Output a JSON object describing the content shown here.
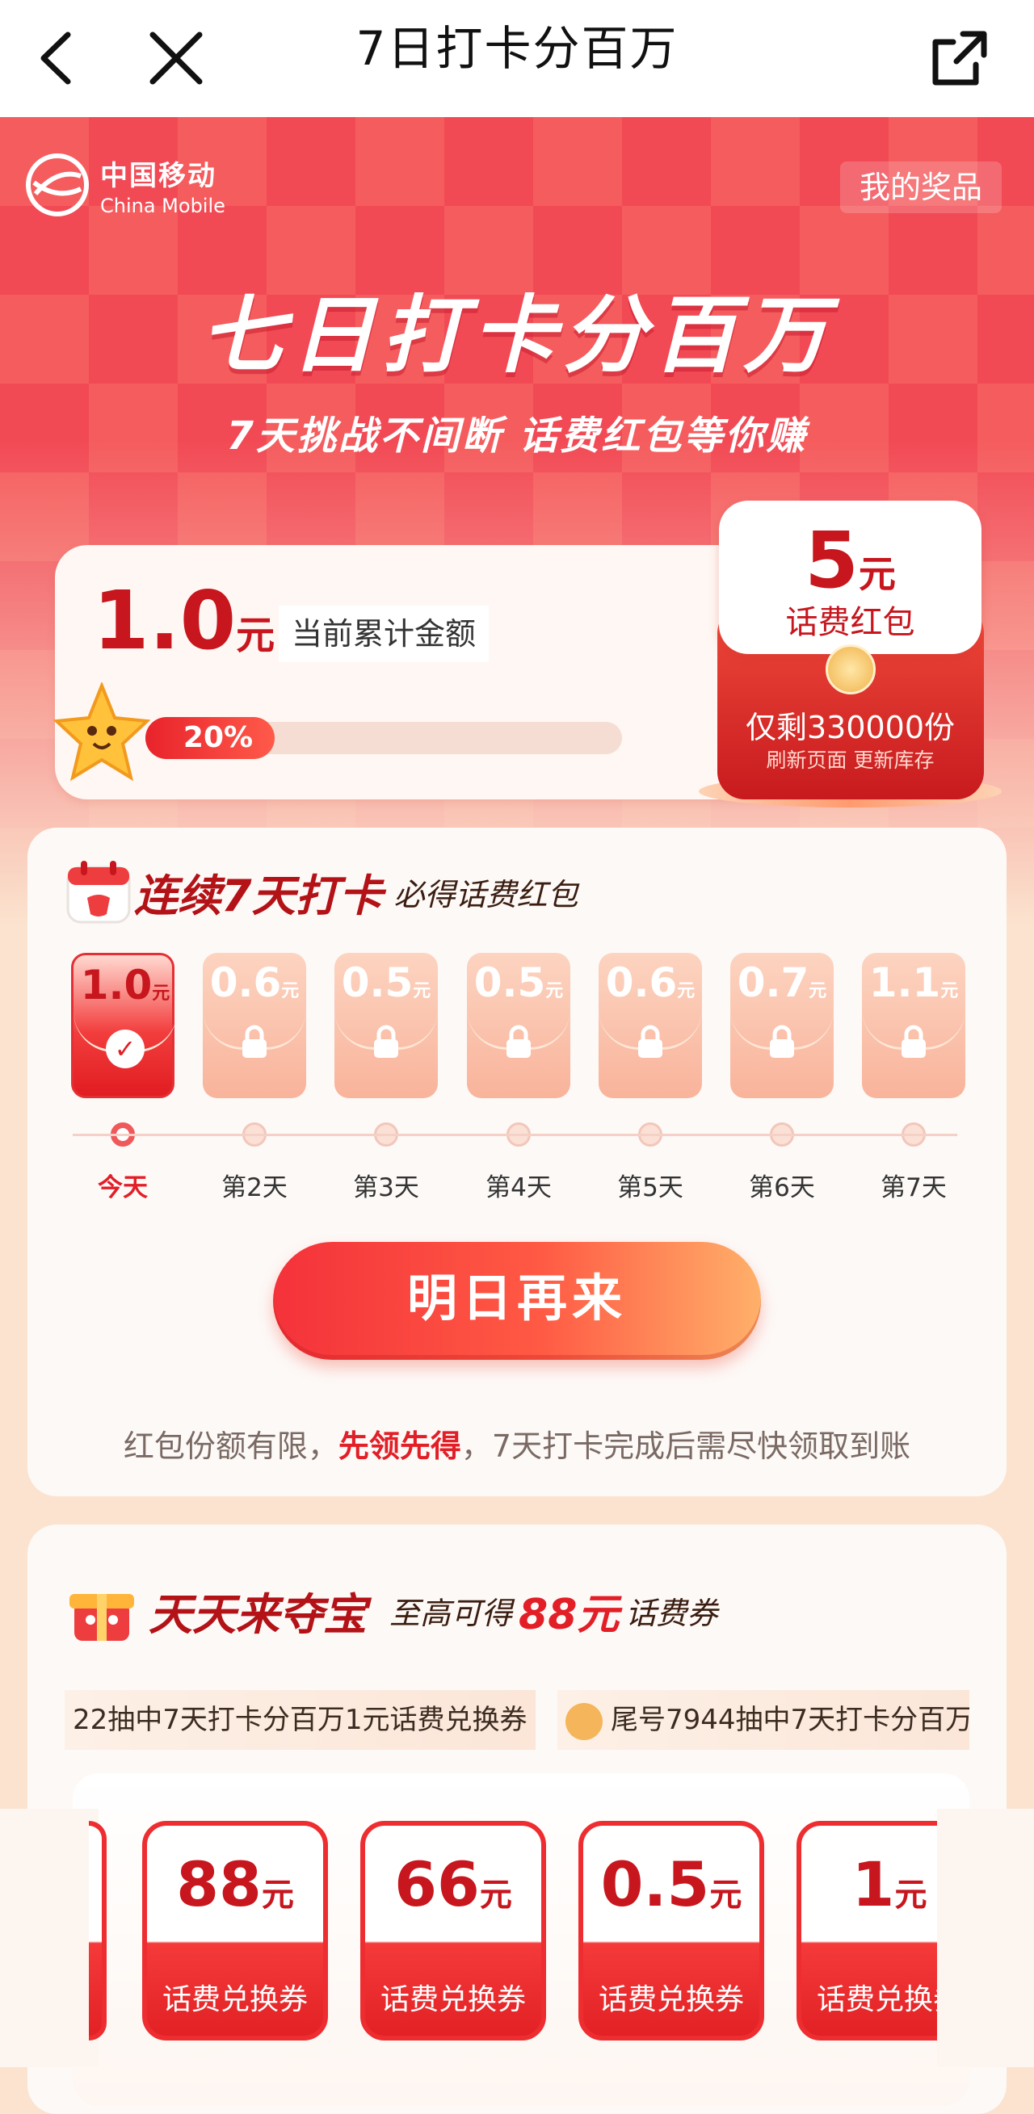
{
  "nav": {
    "title": "7日打卡分百万"
  },
  "brand": {
    "cn": "中国移动",
    "en": "China Mobile"
  },
  "header": {
    "prizes_label": "我的奖品",
    "headline": "七日打卡分百万",
    "subhead": "7天挑战不间断 话费红包等你赚"
  },
  "balance": {
    "amount": "1.0",
    "unit": "元",
    "label": "当前累计金额",
    "progress_text": "20%",
    "progress": 0.2
  },
  "red_packet": {
    "amount": "5",
    "unit": "元",
    "label": "话费红包",
    "remaining": "仅剩330000份",
    "note": "刷新页面 更新库存"
  },
  "checkin": {
    "title": "连续7天打卡",
    "subtitle": "必得话费红包",
    "days": [
      {
        "value": "1.0",
        "unit": "元",
        "label": "今天",
        "today": true
      },
      {
        "value": "0.6",
        "unit": "元",
        "label": "第2天",
        "today": false
      },
      {
        "value": "0.5",
        "unit": "元",
        "label": "第3天",
        "today": false
      },
      {
        "value": "0.5",
        "unit": "元",
        "label": "第4天",
        "today": false
      },
      {
        "value": "0.6",
        "unit": "元",
        "label": "第5天",
        "today": false
      },
      {
        "value": "0.7",
        "unit": "元",
        "label": "第6天",
        "today": false
      },
      {
        "value": "1.1",
        "unit": "元",
        "label": "第7天",
        "today": false
      }
    ],
    "cta": "明日再来",
    "notice_pre": "红包份额有限，",
    "notice_hl": "先领先得",
    "notice_post": "，7天打卡完成后需尽快领取到账"
  },
  "treasure": {
    "title": "天天来夺宝",
    "sub_pre": "至高可得",
    "sub_amount": "88元",
    "sub_post": "话费券",
    "ticker": [
      "22抽中7天打卡分百万1元话费兑换券",
      "尾号7944抽中7天打卡分百万"
    ],
    "coupons": [
      {
        "value": "88",
        "unit": "元",
        "label": "话费兑换券"
      },
      {
        "value": "66",
        "unit": "元",
        "label": "话费兑换券"
      },
      {
        "value": "0.5",
        "unit": "元",
        "label": "话费兑换券"
      },
      {
        "value": "1",
        "unit": "元",
        "label": "话费兑换券"
      }
    ]
  },
  "colors": {
    "brand_red": "#e21e27",
    "accent_orange": "#ff8a4a",
    "nav_bg": "#ffffff"
  }
}
